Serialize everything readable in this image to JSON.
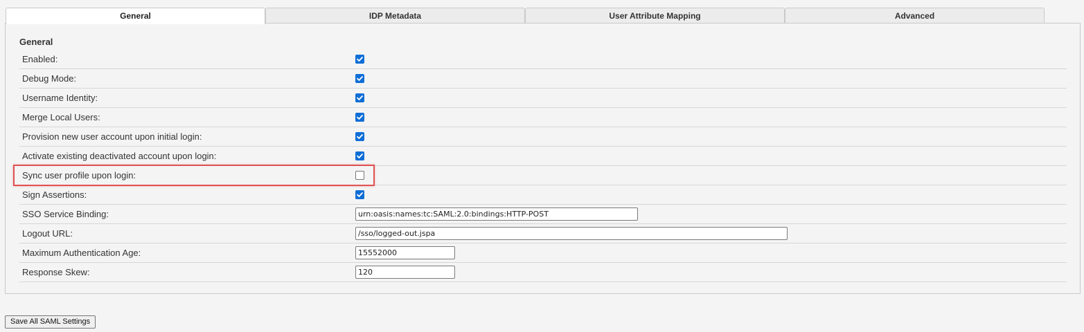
{
  "tabs": [
    {
      "label": "General",
      "active": true
    },
    {
      "label": "IDP Metadata",
      "active": false
    },
    {
      "label": "User Attribute Mapping",
      "active": false
    },
    {
      "label": "Advanced",
      "active": false
    }
  ],
  "section": {
    "title": "General"
  },
  "settings": {
    "enabled": {
      "label": "Enabled:",
      "checked": true
    },
    "debug_mode": {
      "label": "Debug Mode:",
      "checked": true
    },
    "username_identity": {
      "label": "Username Identity:",
      "checked": true
    },
    "merge_local_users": {
      "label": "Merge Local Users:",
      "checked": true
    },
    "provision_new": {
      "label": "Provision new user account upon initial login:",
      "checked": true
    },
    "activate_existing": {
      "label": "Activate existing deactivated account upon login:",
      "checked": true
    },
    "sync_profile": {
      "label": "Sync user profile upon login:",
      "checked": false
    },
    "sign_assertions": {
      "label": "Sign Assertions:",
      "checked": true
    },
    "sso_service_binding": {
      "label": "SSO Service Binding:",
      "value": "urn:oasis:names:tc:SAML:2.0:bindings:HTTP-POST"
    },
    "logout_url": {
      "label": "Logout URL:",
      "value": "/sso/logged-out.jspa"
    },
    "max_auth_age": {
      "label": "Maximum Authentication Age:",
      "value": "15552000"
    },
    "response_skew": {
      "label": "Response Skew:",
      "value": "120"
    }
  },
  "highlight_color": "#e05252",
  "checkbox_color": "#0f6ed6",
  "save_button": {
    "label": "Save All SAML Settings"
  }
}
